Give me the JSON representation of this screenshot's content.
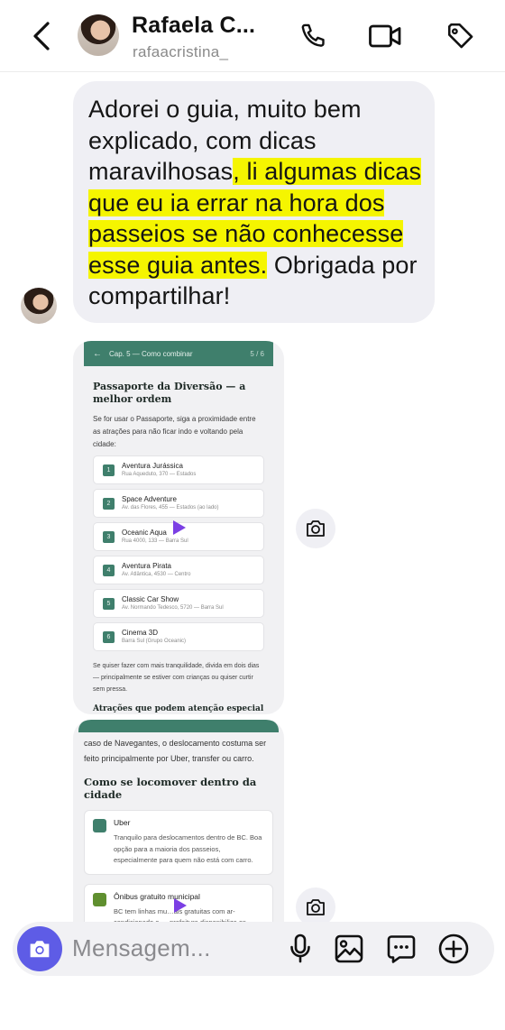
{
  "header": {
    "contact_name": "Rafaela C...",
    "username": "rafaacristina_",
    "icons": [
      "back-chevron-icon",
      "phone-icon",
      "video-camera-icon",
      "tag-icon"
    ]
  },
  "message": {
    "plain_start": "Adorei o guia, muito bem explicado, com dicas maravilhosas",
    "highlighted": ", li algumas dicas que eu ia errar na hora dos passeios se não conhecesse esse guia antes.",
    "plain_end": " Obrigada por compartilhar!"
  },
  "card1": {
    "topbar_label": "Cap. 5 — Como combinar",
    "page": "5 / 6",
    "title": "Passaporte da Diversão — a melhor ordem",
    "intro": "Se for usar o Passaporte, siga a proximidade entre as atrações para não ficar indo e voltando pela cidade:",
    "items": [
      {
        "num": "1",
        "name": "Aventura Jurássica",
        "address": "Rua Aqueduto, 370 — Estados"
      },
      {
        "num": "2",
        "name": "Space Adventure",
        "address": "Av. das Flores, 455 — Estados (ao lado)"
      },
      {
        "num": "3",
        "name": "Oceanic Aqua",
        "address": "Rua 4000, 133 — Barra Sul"
      },
      {
        "num": "4",
        "name": "Aventura Pirata",
        "address": "Av. Atlântica, 4530 — Centro"
      },
      {
        "num": "5",
        "name": "Classic Car Show",
        "address": "Av. Normando Tedesco, 5720 — Barra Sul"
      },
      {
        "num": "6",
        "name": "Cinema 3D",
        "address": "Barra Sul (Grupo Oceanic)"
      }
    ],
    "footer": "Se quiser fazer com mais tranquilidade, divida em dois dias — principalmente se estiver com crianças ou quiser curtir sem pressa.",
    "cut_heading": "Atrações que podem atenção especial"
  },
  "card2": {
    "intro": "caso de Navegantes, o deslocamento costuma ser feito principalmente por Uber, transfer ou carro.",
    "title": "Como se locomover dentro da cidade",
    "options": [
      {
        "name": "Uber",
        "desc": "Tranquilo para deslocamentos dentro de BC. Boa opção para a maioria dos passeios, especialmente para quem não está com carro."
      },
      {
        "name": "Ônibus gratuito municipal",
        "desc": "BC tem linhas mu…ais gratuitas com ar-condicionado e … prefeitura disponibiliza os … oficiais. Ótimo para"
      }
    ]
  },
  "composer": {
    "placeholder": "Mensagem...",
    "icons": [
      "camera-icon",
      "microphone-icon",
      "gallery-icon",
      "sticker-icon",
      "plus-icon"
    ]
  }
}
